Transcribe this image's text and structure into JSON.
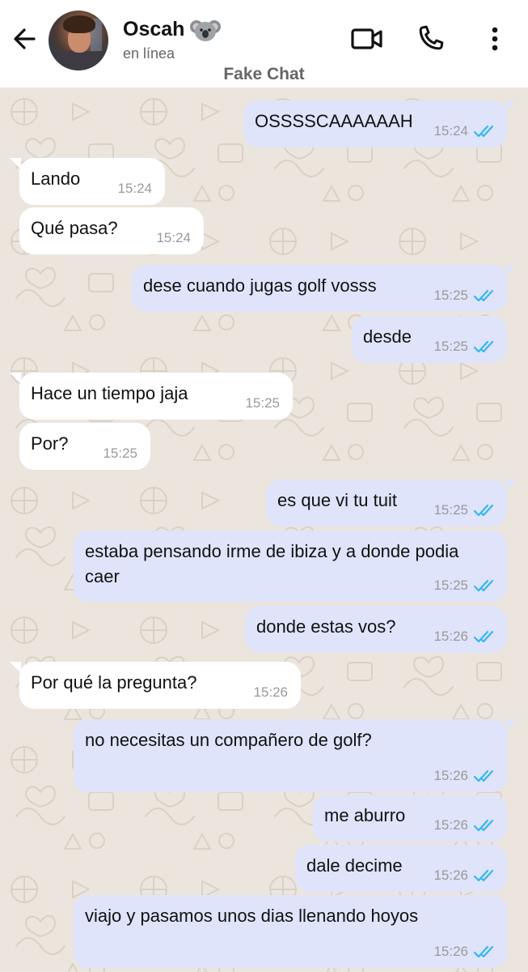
{
  "header": {
    "contact_name": "Oscah",
    "status": "en línea",
    "watermark": "Fake Chat",
    "icons": {
      "back": "arrow-left-icon",
      "video": "video-camera-icon",
      "call": "phone-icon",
      "menu": "more-vert-icon",
      "emoji": "koala-emoji-icon"
    }
  },
  "colors": {
    "header_bg": "#ffffff",
    "chat_bg": "#ece5dd",
    "outgoing_bubble": "#dfe4fb",
    "incoming_bubble": "#ffffff",
    "read_ticks": "#34b7f1"
  },
  "messages": [
    {
      "dir": "out",
      "text": "OSSSSCAAAAAAH",
      "time": "15:24",
      "read": true
    },
    {
      "dir": "in",
      "text": "Lando",
      "time": "15:24"
    },
    {
      "dir": "in",
      "text": "Qué pasa?",
      "time": "15:24"
    },
    {
      "dir": "out",
      "text": "dese cuando jugas golf vosss",
      "time": "15:25",
      "read": true
    },
    {
      "dir": "out",
      "text": "desde",
      "time": "15:25",
      "read": true
    },
    {
      "dir": "in",
      "text": "Hace un tiempo jaja",
      "time": "15:25"
    },
    {
      "dir": "in",
      "text": "Por?",
      "time": "15:25"
    },
    {
      "dir": "out",
      "text": "es que vi tu tuit",
      "time": "15:25",
      "read": true
    },
    {
      "dir": "out",
      "text": "estaba pensando irme de ibiza y a donde podia caer",
      "time": "15:25",
      "read": true
    },
    {
      "dir": "out",
      "text": "donde estas vos?",
      "time": "15:26",
      "read": true
    },
    {
      "dir": "in",
      "text": "Por qué la pregunta?",
      "time": "15:26"
    },
    {
      "dir": "out",
      "text": "no necesitas un compañero de golf?",
      "time": "15:26",
      "read": true
    },
    {
      "dir": "out",
      "text": "me aburro",
      "time": "15:26",
      "read": true
    },
    {
      "dir": "out",
      "text": "dale decime",
      "time": "15:26",
      "read": true
    },
    {
      "dir": "out",
      "text": "viajo y pasamos unos dias llenando hoyos",
      "time": "15:26",
      "read": true
    }
  ]
}
